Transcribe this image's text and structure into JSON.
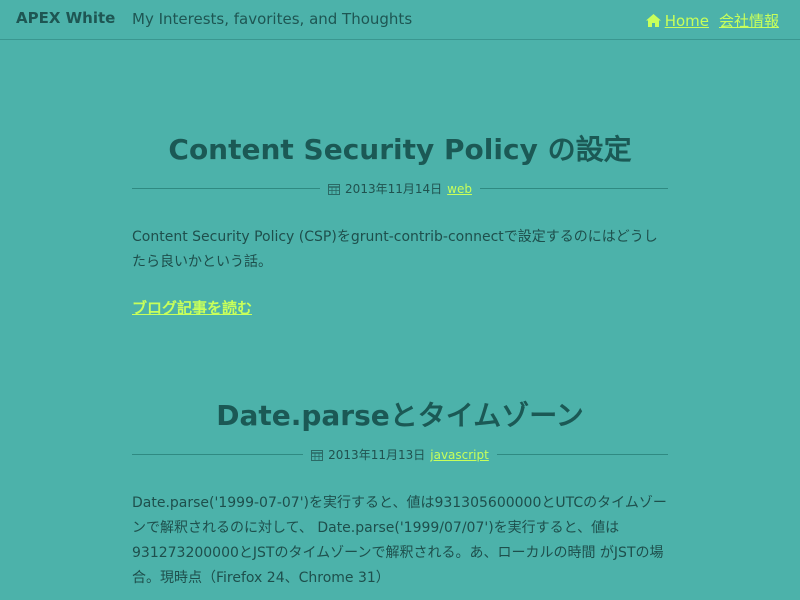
{
  "header": {
    "brand": "APEX White",
    "tagline": "My Interests, favorites, and Thoughts",
    "nav": [
      {
        "label": "Home",
        "icon": "home-icon"
      },
      {
        "label": "会社情報"
      }
    ]
  },
  "posts": [
    {
      "title": "Content Security Policy の設定",
      "date": "2013年11月14日",
      "tag": "web",
      "excerpt": "Content Security Policy (CSP)をgrunt-contrib-connectで設定するのにはどうしたら良いかという話。",
      "read_more": "ブログ記事を読む"
    },
    {
      "title": "Date.parseとタイムゾーン",
      "date": "2013年11月13日",
      "tag": "javascript",
      "excerpt": "Date.parse('1999-07-07')を実行すると、値は931305600000とUTCのタイムゾーンで解釈されるのに対して、 Date.parse('1999/07/07')を実行すると、値は931273200000とJSTのタイムゾーンで解釈される。あ、ローカルの時間 がJSTの場合。現時点（Firefox 24、Chrome 31）"
    }
  ],
  "colors": {
    "background": "#4cb2aa",
    "link": "#c8ff5a",
    "heading": "#1b5955",
    "text": "#1e4f4c"
  }
}
